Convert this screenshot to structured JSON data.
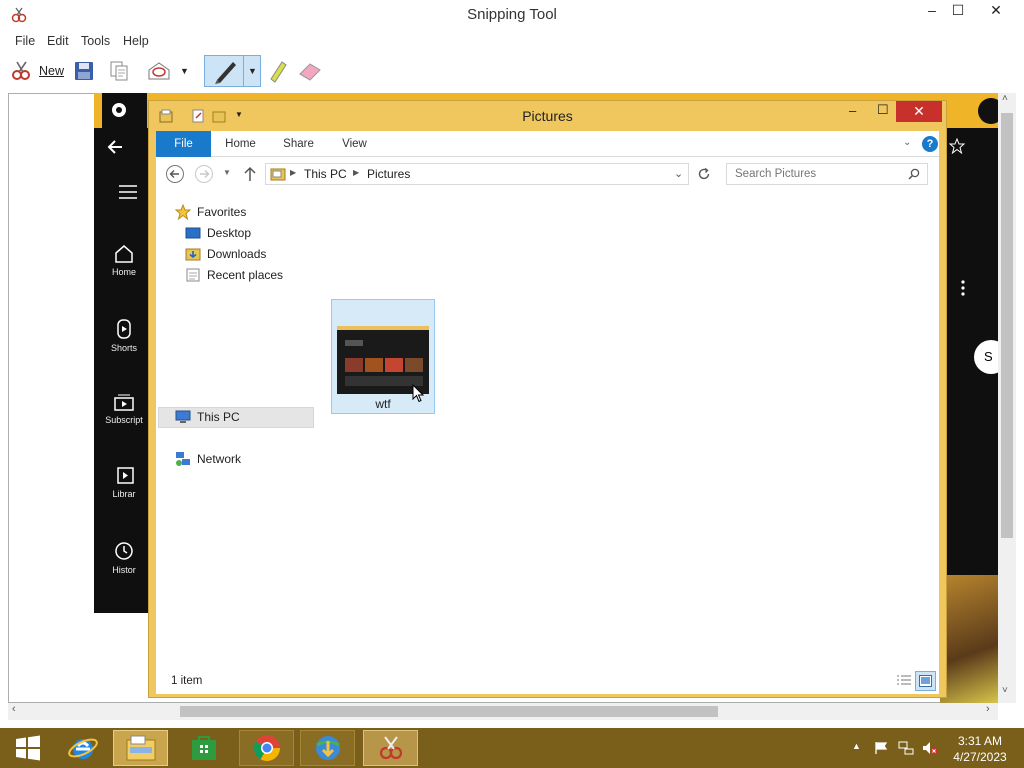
{
  "snipping_tool": {
    "title": "Snipping Tool",
    "window_controls": {
      "minimize": "–",
      "maximize": "☐",
      "close": "✕"
    },
    "menu": [
      "File",
      "Edit",
      "Tools",
      "Help"
    ],
    "toolbar": {
      "new_label": "New"
    }
  },
  "explorer": {
    "title": "Pictures",
    "ribbon_tabs": [
      "File",
      "Home",
      "Share",
      "View"
    ],
    "breadcrumb": [
      "This PC",
      "Pictures"
    ],
    "search_placeholder": "Search Pictures",
    "nav": {
      "favorites": "Favorites",
      "favorites_items": [
        "Desktop",
        "Downloads",
        "Recent places"
      ],
      "this_pc": "This PC",
      "network": "Network"
    },
    "files": [
      {
        "name": "wtf"
      }
    ],
    "status": "1 item",
    "colors": {
      "frame": "#f0c75e",
      "accent": "#1979ca",
      "close": "#c7302b",
      "selection": "#d6eaf8"
    }
  },
  "background_app": {
    "sidebar": [
      "Home",
      "Shorts",
      "Subscript",
      "Librar",
      "Histor"
    ],
    "partial_button": "S",
    "partial_text": "s"
  },
  "taskbar": {
    "time": "3:31 AM",
    "date": "4/27/2023",
    "apps": [
      "start-icon",
      "internet-explorer-icon",
      "file-explorer-icon",
      "store-icon",
      "chrome-icon",
      "internet-download-manager-icon",
      "snipping-tool-icon"
    ],
    "color": "#7a5f1b"
  }
}
